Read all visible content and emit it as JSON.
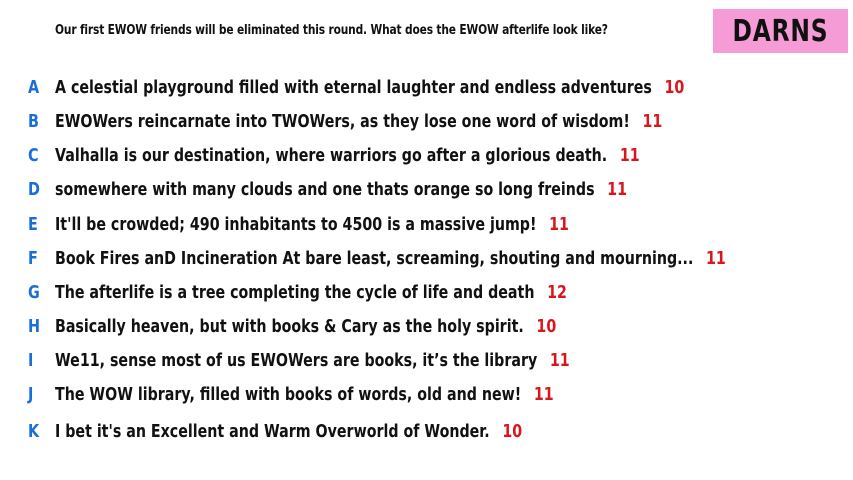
{
  "prompt": "Our first EWOW friends will be eliminated this round. What does the EWOW afterlife look like?",
  "badge": "DARNS",
  "colors": {
    "badge_bg": "#f59bd6",
    "letter": "#1a6fd6",
    "count": "#d8161c"
  },
  "responses": [
    {
      "letter": "A",
      "text": "A celestial playground filled with eternal laughter and endless adventures",
      "count": "10"
    },
    {
      "letter": "B",
      "text": "EWOWers reincarnate into TWOWers, as they lose one word of wisdom!",
      "count": "11"
    },
    {
      "letter": "C",
      "text": "Valhalla is our destination, where warriors go after a glorious death.",
      "count": "11"
    },
    {
      "letter": "D",
      "text": "somewhere with many clouds and one thats orange so long freinds",
      "count": "11"
    },
    {
      "letter": "E",
      "text": "It'll be crowded; 490 inhabitants to 4500 is a massive jump!",
      "count": "11"
    },
    {
      "letter": "F",
      "text": "Book Fires anD Incineration At bare least, screaming, shouting and mourning...",
      "count": "11"
    },
    {
      "letter": "G",
      "text": "The afterlife is a tree completing the cycle of life and death",
      "count": "12"
    },
    {
      "letter": "H",
      "text": "Basically heaven, but with books & Cary as the holy spirit.",
      "count": "10"
    },
    {
      "letter": "I",
      "text": "We11, sense most of us EWOWers are books, it’s the library",
      "count": "11"
    },
    {
      "letter": "J",
      "text": "The WOW library, filled with books of words, old and new!",
      "count": "11"
    },
    {
      "letter": "K",
      "text": "I bet it's an Excellent and Warm Overworld of Wonder.",
      "count": "10"
    }
  ]
}
